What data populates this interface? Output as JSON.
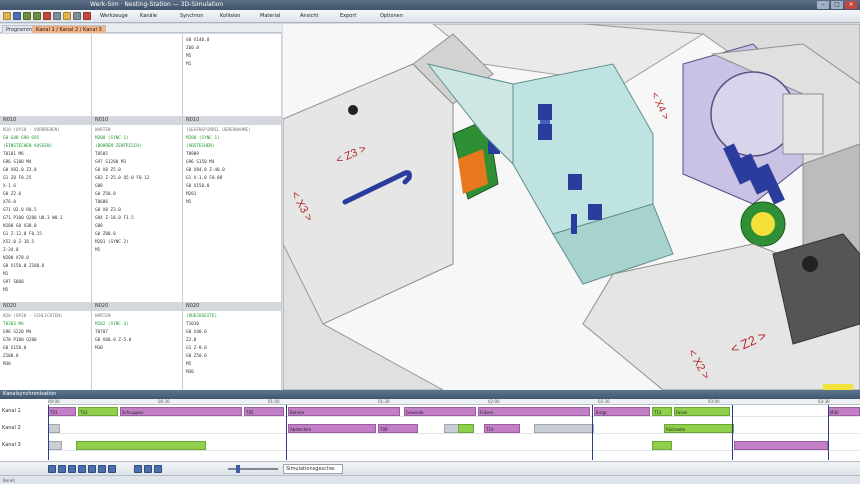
{
  "window": {
    "title": "Werk-Sim · Nesting-Station — 3D-Simulation"
  },
  "toolbar": {
    "items": [
      {
        "icon": "folder-icon",
        "color": "#e3b34a"
      },
      {
        "icon": "save-icon",
        "color": "#4d6fae"
      },
      {
        "icon": "undo-icon",
        "color": "#6b8f3c"
      },
      {
        "icon": "redo-icon",
        "color": "#6b8f3c"
      },
      {
        "icon": "cut-icon",
        "color": "#c4473d"
      },
      {
        "icon": "copy-icon",
        "color": "#7f8c99"
      },
      {
        "icon": "paste-icon",
        "color": "#e3b34a"
      },
      {
        "icon": "print-icon",
        "color": "#7f8c99"
      },
      {
        "icon": "settings-icon",
        "color": "#c4473d"
      }
    ],
    "labels": [
      "Werkzeuge",
      "Kanäle",
      "Synchron",
      "Kollision",
      "Material",
      "Ansicht",
      "Export",
      "Optionen"
    ]
  },
  "tabs": [
    "Programme",
    "Kanal 1 / Kanal 2 / Kanal 3"
  ],
  "code": {
    "columns": [
      {
        "sections": [
          {
            "head": "",
            "lines": []
          },
          {
            "head": "N010",
            "lines": [
              {
                "t": "N10 (OP10 - VORDREHEN)",
                "c": "h"
              },
              {
                "t": "G0 G40 G90 G95",
                "c": "g"
              },
              {
                "t": "(EINSTECHEN AUSSEN)",
                "c": "g"
              },
              {
                "t": "T0101 M6",
                "c": ""
              },
              {
                "t": "G96 S180 M4",
                "c": ""
              },
              {
                "t": "G0 X82.0 Z2.0",
                "c": ""
              },
              {
                "t": "G1 Z0 F0.25",
                "c": ""
              },
              {
                "t": "X-1.6",
                "c": ""
              },
              {
                "t": "G0 Z2.0",
                "c": ""
              },
              {
                "t": "X76.0",
                "c": ""
              },
              {
                "t": "G71 U2.0 R0.5",
                "c": ""
              },
              {
                "t": "G71 P100 Q200 U0.3 W0.1",
                "c": ""
              },
              {
                "t": "N100 G0 X38.0",
                "c": ""
              },
              {
                "t": "G1 Z-12.0 F0.15",
                "c": ""
              },
              {
                "t": "X52.0 Z-18.5",
                "c": ""
              },
              {
                "t": "Z-34.0",
                "c": ""
              },
              {
                "t": "N200 X78.0",
                "c": ""
              },
              {
                "t": "G0 X150.0 Z100.0",
                "c": ""
              },
              {
                "t": "M1",
                "c": ""
              },
              {
                "t": "G97 S800",
                "c": ""
              },
              {
                "t": "M5",
                "c": ""
              }
            ]
          },
          {
            "head": "N020",
            "lines": [
              {
                "t": "N20 (OP20 - SCHLICHTEN)",
                "c": "h"
              },
              {
                "t": "T0303 M6",
                "c": "g"
              },
              {
                "t": "G96 S220 M4",
                "c": ""
              },
              {
                "t": "G70 P100 Q200",
                "c": ""
              },
              {
                "t": "G0 X150.0",
                "c": ""
              },
              {
                "t": "Z100.0",
                "c": ""
              },
              {
                "t": "M30",
                "c": ""
              }
            ]
          }
        ]
      },
      {
        "sections": [
          {
            "head": "",
            "lines": []
          },
          {
            "head": "N010",
            "lines": [
              {
                "t": "WARTEN",
                "c": "h"
              },
              {
                "t": "M200 (SYNC 1)",
                "c": "g"
              },
              {
                "t": "(BOHREN ZENTRISCH)",
                "c": "g"
              },
              {
                "t": "T0505",
                "c": ""
              },
              {
                "t": "G97 S1200 M3",
                "c": ""
              },
              {
                "t": "G0 X0 Z5.0",
                "c": ""
              },
              {
                "t": "G83 Z-25.0 Q5.0 F0.12",
                "c": ""
              },
              {
                "t": "G80",
                "c": ""
              },
              {
                "t": "G0 Z50.0",
                "c": ""
              },
              {
                "t": "T0606",
                "c": ""
              },
              {
                "t": "G0 X0 Z3.0",
                "c": ""
              },
              {
                "t": "G84 Z-18.0 F1.5",
                "c": ""
              },
              {
                "t": "G80",
                "c": ""
              },
              {
                "t": "G0 Z80.0",
                "c": ""
              },
              {
                "t": "M201 (SYNC 2)",
                "c": ""
              },
              {
                "t": "M5",
                "c": ""
              }
            ]
          },
          {
            "head": "N020",
            "lines": [
              {
                "t": "WARTEN",
                "c": "h"
              },
              {
                "t": "M202 (SYNC 3)",
                "c": "g"
              },
              {
                "t": "T0707",
                "c": ""
              },
              {
                "t": "G0 X60.0 Z-5.0",
                "c": ""
              },
              {
                "t": "M30",
                "c": ""
              }
            ]
          }
        ]
      },
      {
        "sections": [
          {
            "head": "",
            "lines": [
              {
                "t": "G0 X140.0",
                "c": ""
              },
              {
                "t": "Z60.0",
                "c": ""
              },
              {
                "t": "M5",
                "c": ""
              },
              {
                "t": "M1",
                "c": ""
              }
            ]
          },
          {
            "head": "N010",
            "lines": [
              {
                "t": "(GEGENSPINDEL UEBERNAHME)",
                "c": "h"
              },
              {
                "t": "M200 (SYNC 1)",
                "c": "g"
              },
              {
                "t": "(ABSTECHEN)",
                "c": "g"
              },
              {
                "t": "T0909",
                "c": ""
              },
              {
                "t": "G96 S150 M4",
                "c": ""
              },
              {
                "t": "G0 X84.0 Z-40.0",
                "c": ""
              },
              {
                "t": "G1 X-1.0 F0.08",
                "c": ""
              },
              {
                "t": "G0 X150.0",
                "c": ""
              },
              {
                "t": "M201",
                "c": ""
              },
              {
                "t": "M5",
                "c": ""
              }
            ]
          },
          {
            "head": "N020",
            "lines": [
              {
                "t": "(RUECKSEITE)",
                "c": "g"
              },
              {
                "t": "T1010",
                "c": ""
              },
              {
                "t": "G0 X40.0",
                "c": ""
              },
              {
                "t": "Z2.0",
                "c": ""
              },
              {
                "t": "G1 Z-8.0",
                "c": ""
              },
              {
                "t": "G0 Z50.0",
                "c": ""
              },
              {
                "t": "M5",
                "c": ""
              },
              {
                "t": "M30",
                "c": ""
              }
            ]
          }
        ]
      }
    ]
  },
  "view3d": {
    "axis_labels": [
      "<Z3>",
      "<X3>",
      "<Z2>",
      "<X2>",
      "<X4>"
    ],
    "colors": {
      "body": "#e9e9e9",
      "teal": "#bfe3e0",
      "purple": "#c9c2e4",
      "green": "#2f8f35",
      "blue": "#2b3d9c",
      "yellow": "#f2e23a"
    }
  },
  "timeline": {
    "title": "Kanalsynchronisation",
    "ruler": [
      "00:00",
      "00:30",
      "01:00",
      "01:30",
      "02:00",
      "02:30",
      "03:00",
      "03:30"
    ],
    "tracks": [
      {
        "label": "Kanal 1",
        "blocks": [
          {
            "s": 0,
            "w": 28,
            "c": "purple",
            "t": "T01"
          },
          {
            "s": 30,
            "w": 40,
            "c": "green",
            "t": "T03"
          },
          {
            "s": 72,
            "w": 122,
            "c": "purple",
            "t": "Schruppen"
          },
          {
            "s": 196,
            "w": 40,
            "c": "purple",
            "t": "T05"
          },
          {
            "s": 240,
            "w": 112,
            "c": "purple",
            "t": "Bohren"
          },
          {
            "s": 356,
            "w": 72,
            "c": "purple",
            "t": "Gewinde"
          },
          {
            "s": 430,
            "w": 112,
            "c": "purple",
            "t": "Fräsen"
          },
          {
            "s": 546,
            "w": 56,
            "c": "purple",
            "t": "Entgr."
          },
          {
            "s": 604,
            "w": 20,
            "c": "green",
            "t": "T12"
          },
          {
            "s": 626,
            "w": 56,
            "c": "green",
            "t": "Fasen"
          },
          {
            "s": 780,
            "w": 32,
            "c": "purple",
            "t": "M30"
          }
        ]
      },
      {
        "label": "Kanal 2",
        "blocks": [
          {
            "s": 0,
            "w": 12,
            "c": "grey",
            "t": ""
          },
          {
            "s": 240,
            "w": 88,
            "c": "purple",
            "t": "Abstechen"
          },
          {
            "s": 330,
            "w": 40,
            "c": "purple",
            "t": "T09"
          },
          {
            "s": 396,
            "w": 24,
            "c": "grey",
            "t": ""
          },
          {
            "s": 410,
            "w": 16,
            "c": "green",
            "t": ""
          },
          {
            "s": 436,
            "w": 36,
            "c": "purple",
            "t": "T10"
          },
          {
            "s": 486,
            "w": 60,
            "c": "grey",
            "t": ""
          },
          {
            "s": 616,
            "w": 70,
            "c": "green",
            "t": "Rückseite"
          }
        ]
      },
      {
        "label": "Kanal 3",
        "blocks": [
          {
            "s": 0,
            "w": 14,
            "c": "grey",
            "t": ""
          },
          {
            "s": 28,
            "w": 130,
            "c": "green",
            "t": ""
          },
          {
            "s": 604,
            "w": 20,
            "c": "green",
            "t": ""
          },
          {
            "s": 686,
            "w": 94,
            "c": "purple",
            "t": ""
          }
        ]
      }
    ],
    "sync_lines": [
      0,
      238,
      544,
      684,
      780
    ]
  },
  "controls": {
    "buttons": [
      "rewind-icon",
      "step-back-icon",
      "play-icon",
      "pause-icon",
      "stop-icon",
      "step-forward-icon",
      "fast-forward-icon",
      "zoom-in-icon",
      "zoom-out-icon",
      "fit-icon"
    ],
    "speed_value": 0.2,
    "dropdown": "Simulationsgeschw.",
    "status": "Bereit"
  }
}
